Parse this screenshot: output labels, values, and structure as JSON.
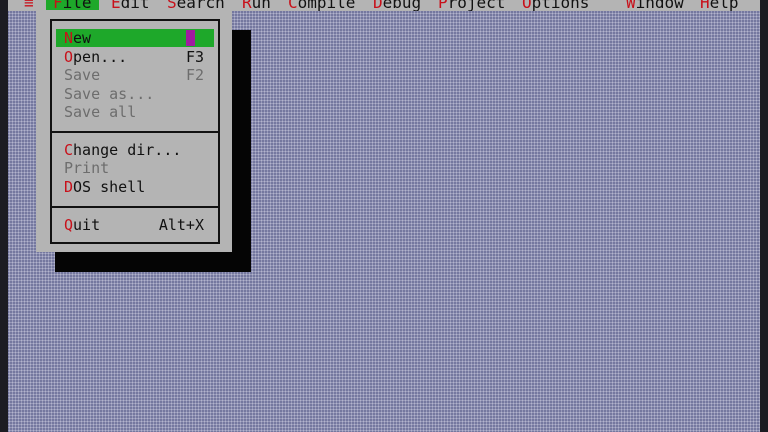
{
  "menubar": {
    "system_glyph": "≡",
    "items": [
      {
        "hot": "F",
        "rest": "ile"
      },
      {
        "hot": "E",
        "rest": "dit"
      },
      {
        "hot": "S",
        "rest": "earch"
      },
      {
        "hot": "R",
        "rest": "un"
      },
      {
        "hot": "C",
        "rest": "ompile"
      },
      {
        "hot": "D",
        "rest": "ebug"
      },
      {
        "hot": "P",
        "rest": "roject"
      },
      {
        "hot": "O",
        "rest": "ptions"
      },
      {
        "hot": "W",
        "rest": "indow"
      },
      {
        "hot": "H",
        "rest": "elp"
      }
    ],
    "active_menu": "File"
  },
  "file_menu": {
    "items": [
      {
        "hot": "N",
        "rest": "ew",
        "shortcut": "",
        "state": "selected"
      },
      {
        "hot": "O",
        "rest": "pen...",
        "shortcut": "F3",
        "state": "enabled"
      },
      {
        "hot": "",
        "rest": "Save",
        "shortcut": "F2",
        "state": "disabled"
      },
      {
        "hot": "",
        "rest": "Save as...",
        "shortcut": "",
        "state": "disabled"
      },
      {
        "hot": "",
        "rest": "Save all",
        "shortcut": "",
        "state": "disabled"
      },
      {
        "hot": "C",
        "rest": "hange dir...",
        "shortcut": "",
        "state": "enabled"
      },
      {
        "hot": "",
        "rest": "Print",
        "shortcut": "",
        "state": "disabled"
      },
      {
        "hot": "D",
        "rest": "OS shell",
        "shortcut": "",
        "state": "enabled"
      },
      {
        "hot": "Q",
        "rest": "uit",
        "shortcut": "Alt+X",
        "state": "enabled"
      }
    ]
  },
  "colors": {
    "menubar_bg": "#b4b4b4",
    "highlight": "#1ea82a",
    "hotkey": "#c8101a",
    "disabled_text": "#6d6d6d",
    "desktop": "#7b7ea6",
    "cursor": "#a01ca0"
  }
}
